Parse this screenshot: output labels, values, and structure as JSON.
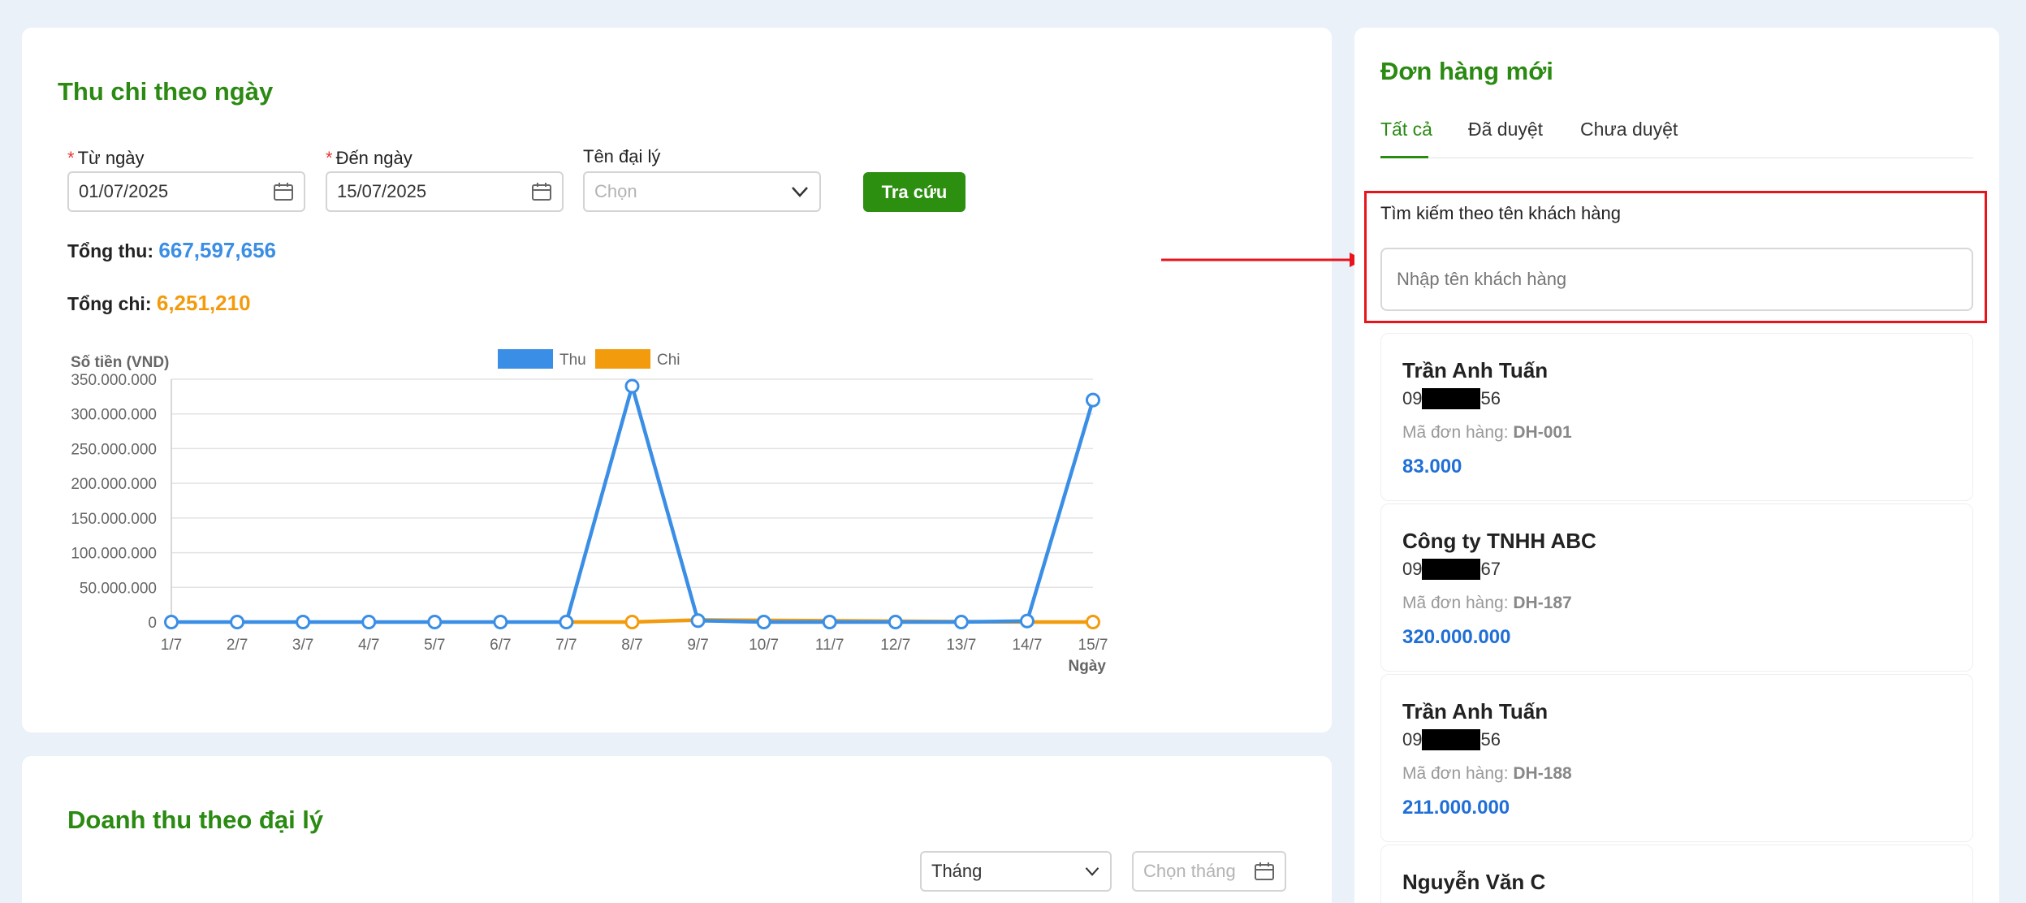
{
  "daily": {
    "title": "Thu chi theo ngày",
    "from_label": "Từ ngày",
    "from_value": "01/07/2025",
    "to_label": "Đến ngày",
    "to_value": "15/07/2025",
    "agent_label": "Tên đại lý",
    "agent_placeholder": "Chọn",
    "search_button": "Tra cứu",
    "total_in_label": "Tổng thu:",
    "total_in_value": "667,597,656",
    "total_out_label": "Tổng chi:",
    "total_out_value": "6,251,210"
  },
  "colors": {
    "thu": "#3a8ee6",
    "chi": "#f29b0d",
    "accent": "#2a8a12"
  },
  "chart_data": {
    "type": "line",
    "ylabel": "Số tiền (VND)",
    "xlabel": "Ngày",
    "ylim": [
      0,
      350000000
    ],
    "yticks": [
      "0",
      "50.000.000",
      "100.000.000",
      "150.000.000",
      "200.000.000",
      "250.000.000",
      "300.000.000",
      "350.000.000"
    ],
    "categories": [
      "1/7",
      "2/7",
      "3/7",
      "4/7",
      "5/7",
      "6/7",
      "7/7",
      "8/7",
      "9/7",
      "10/7",
      "11/7",
      "12/7",
      "13/7",
      "14/7",
      "15/7"
    ],
    "legend_position": "top",
    "series": [
      {
        "name": "Thu",
        "values": [
          0,
          0,
          0,
          0,
          0,
          0,
          0,
          340000000,
          2000000,
          0,
          0,
          0,
          0,
          1500000,
          320000000
        ]
      },
      {
        "name": "Chi",
        "values": [
          null,
          null,
          null,
          null,
          null,
          null,
          0,
          0,
          3000000,
          null,
          null,
          null,
          null,
          0,
          0
        ]
      }
    ]
  },
  "agent_revenue": {
    "title": "Doanh thu theo đại lý",
    "period_select": "Tháng",
    "month_placeholder": "Chọn tháng"
  },
  "orders": {
    "title": "Đơn hàng mới",
    "tabs": [
      {
        "label": "Tất cả"
      },
      {
        "label": "Đã duyệt"
      },
      {
        "label": "Chưa duyệt"
      }
    ],
    "search_label": "Tìm kiếm theo tên khách hàng",
    "search_placeholder": "Nhập tên khách hàng",
    "code_label": "Mã đơn hàng:",
    "items": [
      {
        "name": "Trần Anh Tuấn",
        "phone_pre": "09",
        "phone_post": "56",
        "code": "DH-001",
        "amount": "83.000"
      },
      {
        "name": "Công ty TNHH ABC",
        "phone_pre": "09",
        "phone_post": "67",
        "code": "DH-187",
        "amount": "320.000.000"
      },
      {
        "name": "Trần Anh Tuấn",
        "phone_pre": "09",
        "phone_post": "56",
        "code": "DH-188",
        "amount": "211.000.000"
      },
      {
        "name": "Nguyễn Văn C"
      }
    ]
  }
}
